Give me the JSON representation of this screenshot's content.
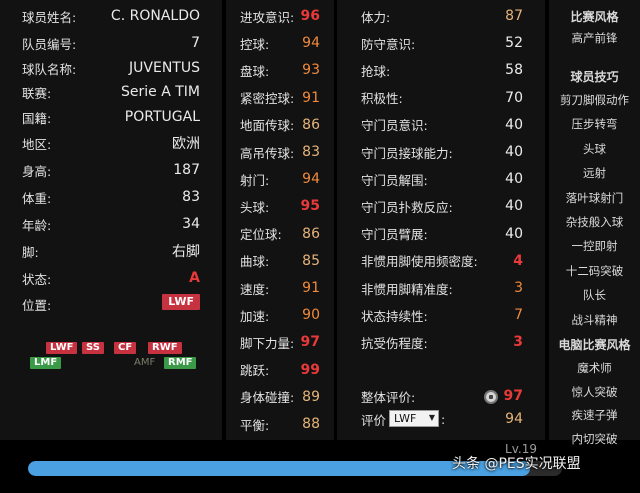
{
  "player": {
    "name_label": "球员姓名:",
    "name": "C. RONALDO",
    "number_label": "队员编号:",
    "number": "7",
    "team_label": "球队名称:",
    "team": "JUVENTUS",
    "league_label": "联赛:",
    "league": "Serie A TIM",
    "nationality_label": "国籍:",
    "nationality": "PORTUGAL",
    "region_label": "地区:",
    "region": "欧洲",
    "height_label": "身高:",
    "height": "187",
    "weight_label": "体重:",
    "weight": "83",
    "age_label": "年龄:",
    "age": "34",
    "foot_label": "脚:",
    "foot": "右脚",
    "condition_label": "状态:",
    "condition": "A",
    "position_label": "位置:",
    "position": "LWF"
  },
  "position_map": {
    "row1": [
      "LWF",
      "SS",
      "CF",
      "RWF"
    ],
    "row2_left": "LMF",
    "row2_mid": "AMF",
    "row2_right": "RMF"
  },
  "attack_stats": [
    {
      "label": "进攻意识:",
      "value": "96",
      "tone": "red"
    },
    {
      "label": "控球:",
      "value": "94",
      "tone": "orange"
    },
    {
      "label": "盘球:",
      "value": "93",
      "tone": "orange"
    },
    {
      "label": "紧密控球:",
      "value": "91",
      "tone": "orange"
    },
    {
      "label": "地面传球:",
      "value": "86",
      "tone": "tan"
    },
    {
      "label": "高吊传球:",
      "value": "83",
      "tone": "tan"
    },
    {
      "label": "射门:",
      "value": "94",
      "tone": "orange"
    },
    {
      "label": "头球:",
      "value": "95",
      "tone": "red"
    },
    {
      "label": "定位球:",
      "value": "86",
      "tone": "tan"
    },
    {
      "label": "曲球:",
      "value": "85",
      "tone": "tan"
    },
    {
      "label": "速度:",
      "value": "91",
      "tone": "orange"
    },
    {
      "label": "加速:",
      "value": "90",
      "tone": "orange"
    },
    {
      "label": "脚下力量:",
      "value": "97",
      "tone": "red"
    },
    {
      "label": "跳跃:",
      "value": "99",
      "tone": "red"
    },
    {
      "label": "身体碰撞:",
      "value": "89",
      "tone": "tan"
    },
    {
      "label": "平衡:",
      "value": "88",
      "tone": "tan"
    }
  ],
  "other_stats": [
    {
      "label": "体力:",
      "value": "87",
      "tone": "tan"
    },
    {
      "label": "防守意识:",
      "value": "52",
      "tone": "white"
    },
    {
      "label": "抢球:",
      "value": "58",
      "tone": "white"
    },
    {
      "label": "积极性:",
      "value": "70",
      "tone": "white"
    },
    {
      "label": "守门员意识:",
      "value": "40",
      "tone": "white"
    },
    {
      "label": "守门员接球能力:",
      "value": "40",
      "tone": "white"
    },
    {
      "label": "守门员解围:",
      "value": "40",
      "tone": "white"
    },
    {
      "label": "守门员扑救反应:",
      "value": "40",
      "tone": "white"
    },
    {
      "label": "守门员臂展:",
      "value": "40",
      "tone": "white"
    },
    {
      "label": "非惯用脚使用频密度:",
      "value": "4",
      "tone": "red"
    },
    {
      "label": "非惯用脚精准度:",
      "value": "3",
      "tone": "orange"
    },
    {
      "label": "状态持续性:",
      "value": "7",
      "tone": "orange"
    },
    {
      "label": "抗受伤程度:",
      "value": "3",
      "tone": "red"
    }
  ],
  "overall": {
    "label": "整体评价:",
    "value": "97",
    "rating_label": "评价",
    "rating_position": "LWF",
    "rating_suffix": ":",
    "rating_value": "94",
    "select_arrow": "▼"
  },
  "sidebar": {
    "style_title": "比赛风格",
    "style_items": [
      "高产前锋"
    ],
    "skills_title": "球员技巧",
    "skills_items": [
      "剪刀脚假动作",
      "压步转弯",
      "头球",
      "远射",
      "落叶球射门",
      "杂技般入球",
      "一控即射",
      "十二码突破",
      "队长",
      "战斗精神"
    ],
    "ai_title": "电脑比赛风格",
    "ai_items": [
      "魔术师",
      "惊人突破",
      "疾速子弹",
      "内切突破"
    ]
  },
  "progress": {
    "level": "Lv.19",
    "fill": 0.94
  },
  "watermark": "头条 @PES实况联盟"
}
